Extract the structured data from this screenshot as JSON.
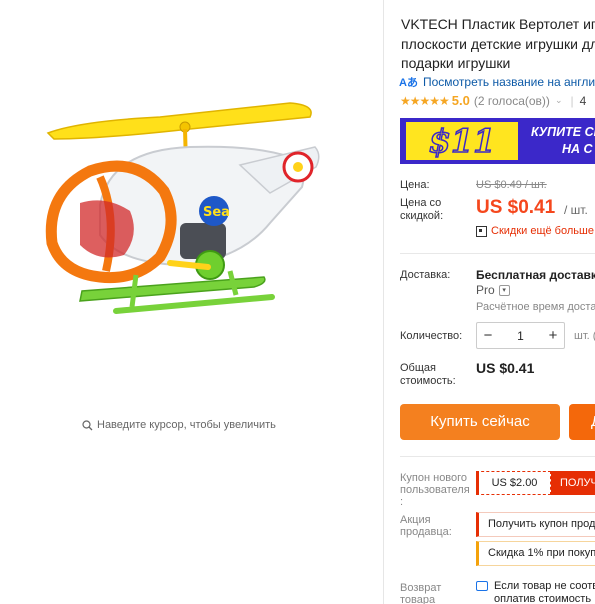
{
  "gallery": {
    "zoom_hint": "Наведите курсор, чтобы увеличить"
  },
  "product": {
    "title_lines": [
      "VKTECH Пластик Вертолет игру",
      "плоскости детские игрушки для",
      "подарки игрушки"
    ],
    "toy_badge": "Sea"
  },
  "translate": {
    "icon": "Aあ",
    "label": "Посмотреть название на англий"
  },
  "rating": {
    "stars": "★★★★★",
    "value": "5.0",
    "votes": "(2 голоса(ов))",
    "chevron": "⌄",
    "separator": "|",
    "orders": "4"
  },
  "banner": {
    "price": "$11",
    "line1": "КУПИТЕ СЕ",
    "line2": "НА С",
    "colors": {
      "background": "#3b28c9",
      "accent": "#ffe51f"
    }
  },
  "pricing": {
    "price_label": "Цена:",
    "old_price": "US $0.49 / шт.",
    "discount_label_line1": "Цена со",
    "discount_label_line2": "скидкой:",
    "discount_price": "US $0.41",
    "per_unit": "/ шт.",
    "coupon_more": "Скидки ещё больше",
    "accent_color": "#f5471d"
  },
  "shipping": {
    "label": "Доставка:",
    "value": "Бесплатная доставка",
    "pro": "Pro",
    "eta": "Расчётное время доста"
  },
  "quantity": {
    "label": "Количество:",
    "minus": "−",
    "value": "1",
    "plus": "+",
    "unit": "шт. ("
  },
  "total": {
    "label_line1": "Общая",
    "label_line2": "стоимость:",
    "value": "US $0.41"
  },
  "actions": {
    "buy_now": "Купить сейчас",
    "add_to_cart": "Д",
    "buy_color": "#f4801f"
  },
  "coupon": {
    "label_line1": "Купон нового",
    "label_line2": "пользователя",
    "label_line3": ":",
    "amount": "US $2.00",
    "get": "ПОЛУЧ"
  },
  "promo": {
    "label_line1": "Акция",
    "label_line2": "продавца:",
    "offer1": "Получить купон прод",
    "offer2": "Скидка 1% при покуп"
  },
  "returns": {
    "label_line1": "Возврат",
    "label_line2": "товара",
    "text1": "Если товар не соотв",
    "text2": "оплатив стоимость"
  }
}
